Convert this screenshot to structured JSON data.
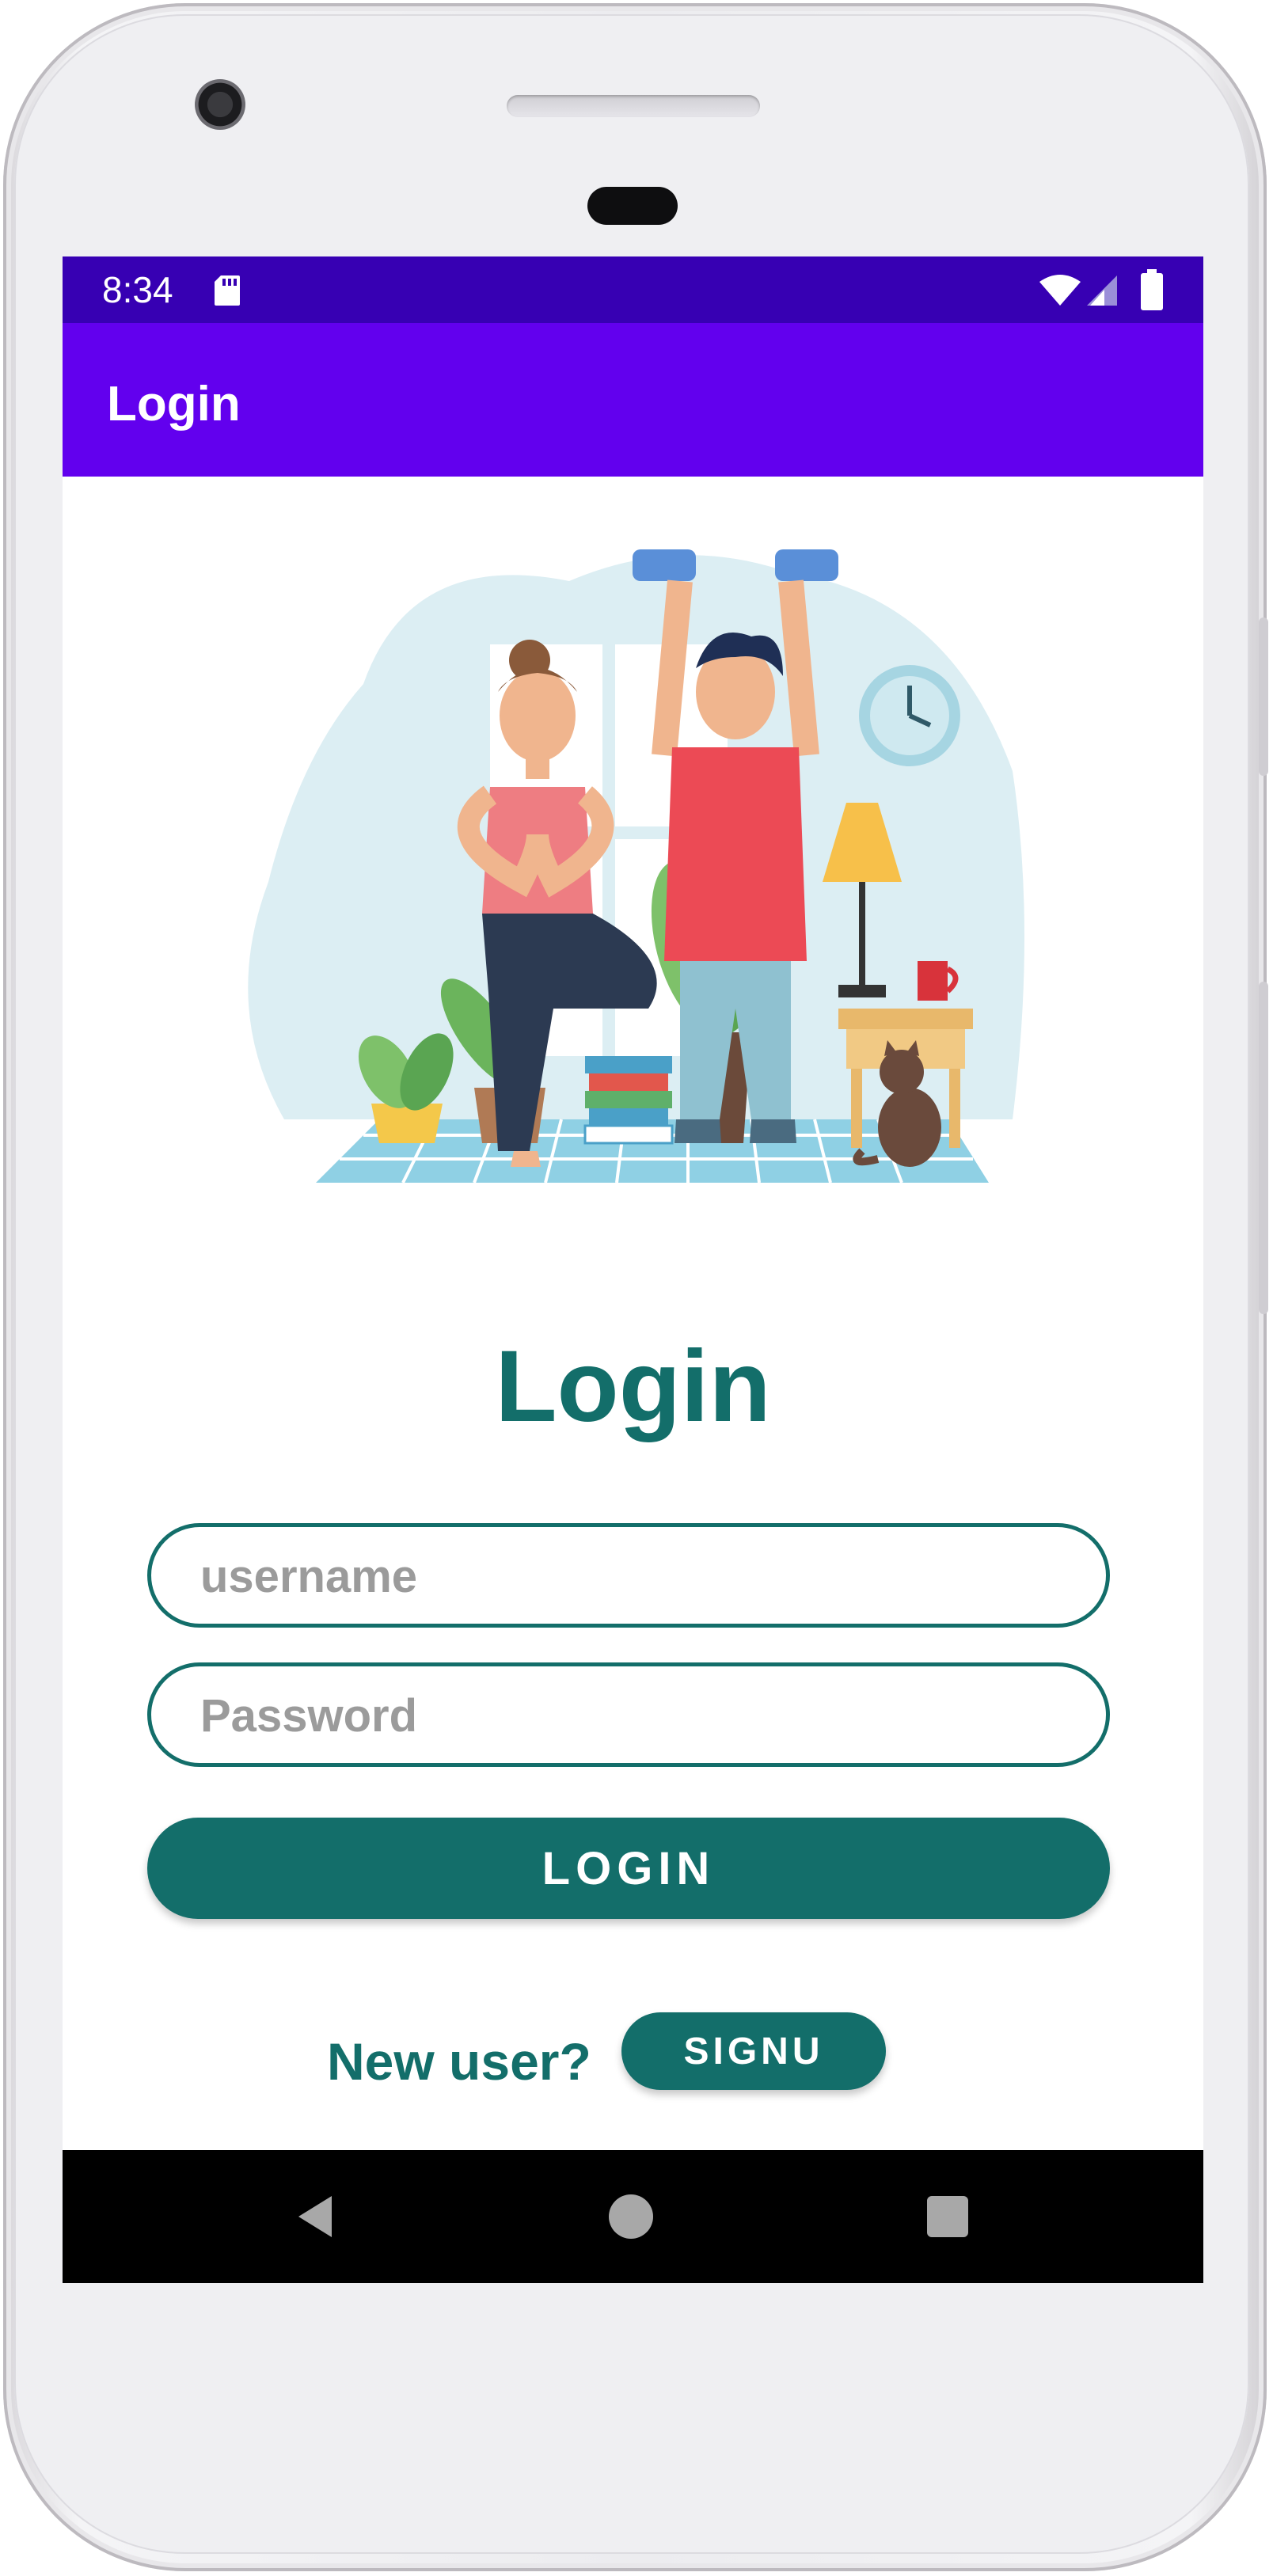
{
  "status_bar": {
    "time": "8:34",
    "icons": [
      "sd-card-icon",
      "wifi-icon",
      "cell-signal-icon",
      "battery-icon"
    ]
  },
  "app_bar": {
    "title": "Login"
  },
  "illustration": {
    "description_icon": "fitness-couple-illustration"
  },
  "main": {
    "heading": "Login",
    "username": {
      "value": "",
      "placeholder": "username"
    },
    "password": {
      "value": "",
      "placeholder": "Password"
    },
    "login_button": "LOGIN",
    "new_user_label": "New user?",
    "signup_button": "SIGNU"
  },
  "nav_bar": {
    "icons": [
      "back-icon",
      "home-icon",
      "recents-icon"
    ]
  },
  "colors": {
    "status_bar": "#3700b3",
    "app_bar": "#6200ee",
    "accent": "#136e6a",
    "nav_bar": "#000000"
  }
}
